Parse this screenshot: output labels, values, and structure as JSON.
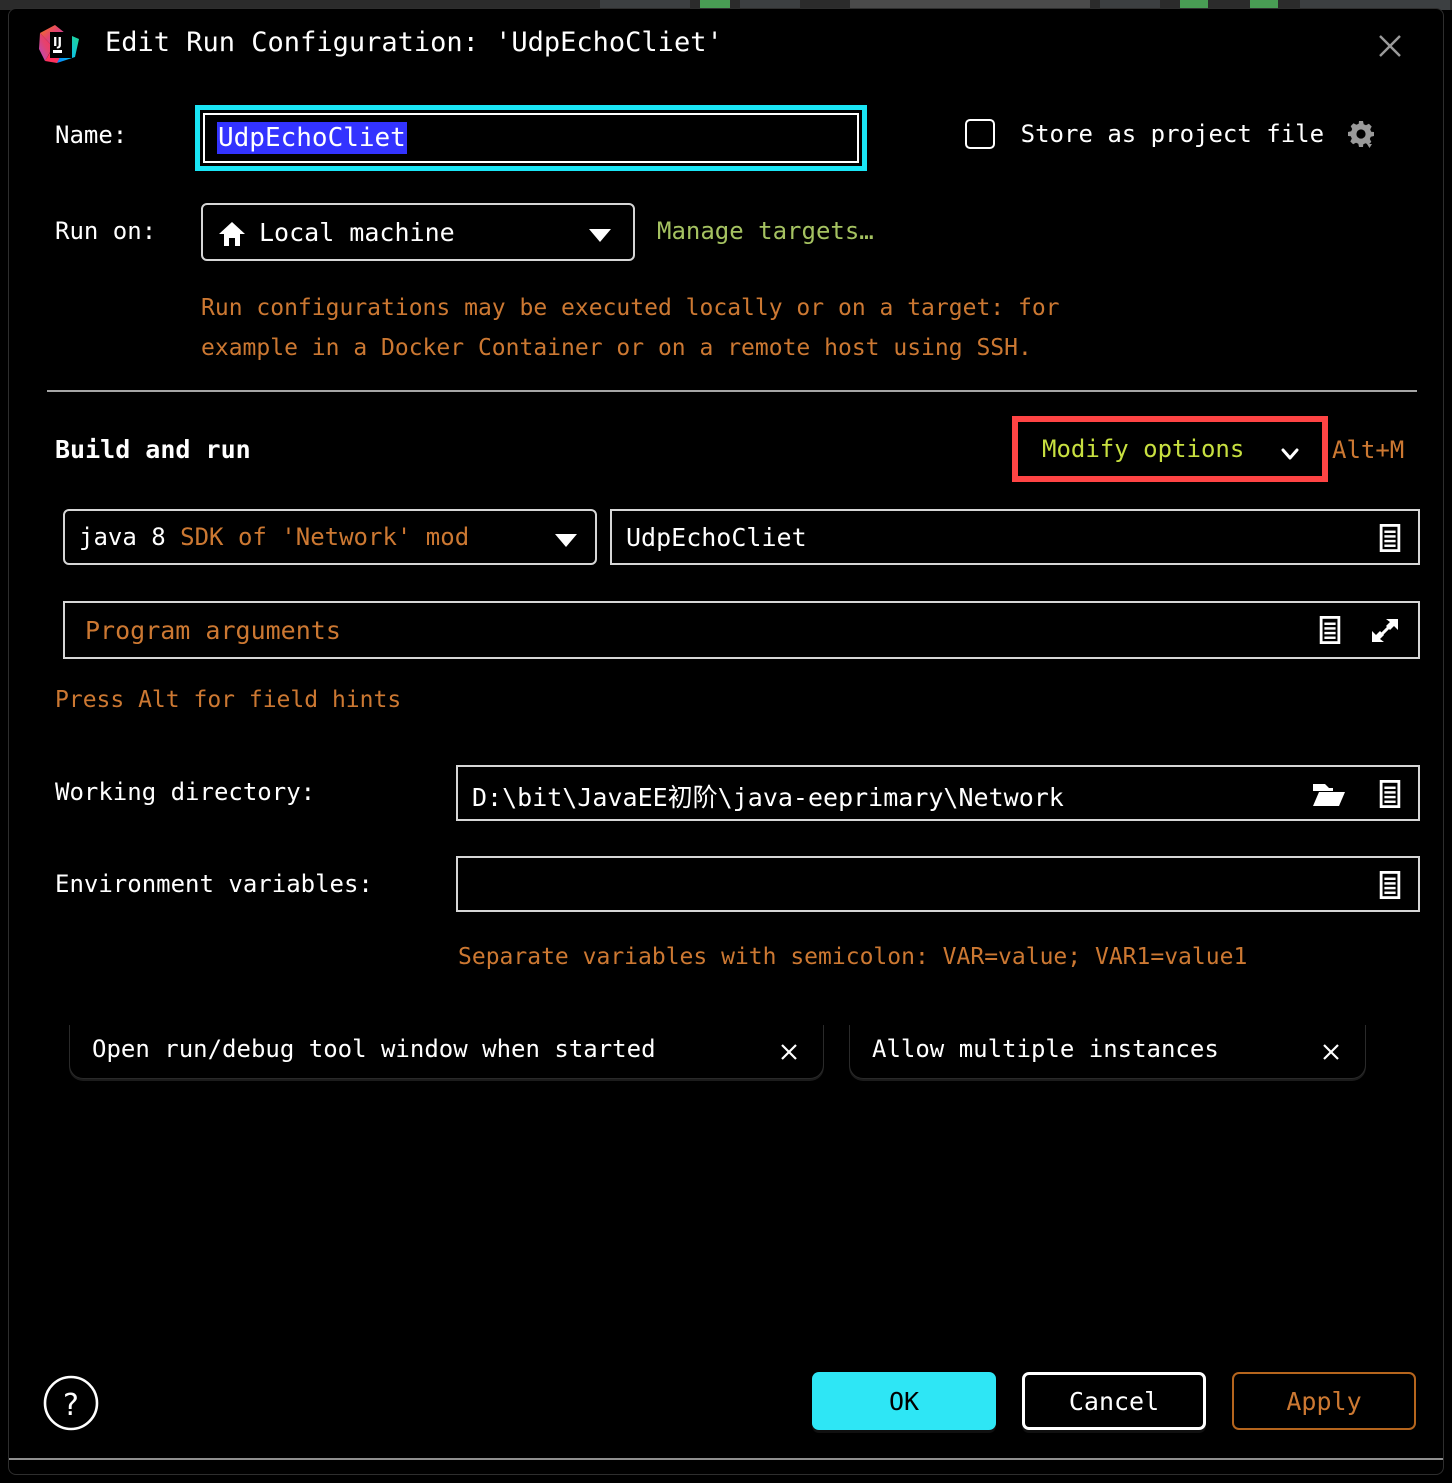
{
  "window": {
    "title": "Edit Run Configuration: 'UdpEchoCliet'",
    "logo_icon": "intellij-idea-logo",
    "close_icon": "close-icon"
  },
  "name_row": {
    "label": "Name:",
    "value": "UdpEchoCliet",
    "store_as_project_file_label": "Store as project file",
    "store_as_project_file_checked": false,
    "gear_icon": "gear-icon"
  },
  "run_on": {
    "label": "Run on:",
    "selected": "Local machine",
    "machine_icon": "home-icon",
    "manage_targets_link": "Manage targets…",
    "hint_line_1": "Run configurations may be executed locally or on a target: for",
    "hint_line_2": "example in a Docker Container or on a remote host using SSH."
  },
  "build_and_run": {
    "section_title": "Build and run",
    "modify_options_label": "Modify options",
    "modify_options_shortcut": "Alt+M",
    "sdk_prefix": "java 8",
    "sdk_suffix": "SDK of 'Network' mod",
    "main_class": "UdpEchoCliet",
    "program_arguments_placeholder": "Program arguments",
    "field_hints": "Press Alt for field hints"
  },
  "working_directory": {
    "label": "Working directory:",
    "value": "D:\\bit\\JavaEE初阶\\java-eeprimary\\Network",
    "browse_icon": "folder-icon",
    "macro_icon": "list-icon"
  },
  "environment_variables": {
    "label": "Environment variables:",
    "value": "",
    "macro_icon": "list-icon",
    "hint": "Separate variables with semicolon: VAR=value; VAR1=value1"
  },
  "option_chips": [
    {
      "label": "Open run/debug tool window when started",
      "remove_icon": "close-icon"
    },
    {
      "label": "Allow multiple instances",
      "remove_icon": "close-icon"
    }
  ],
  "footer": {
    "help_icon": "question-mark-icon",
    "ok_label": "OK",
    "cancel_label": "Cancel",
    "apply_label": "Apply"
  },
  "colors": {
    "accent_cyan": "#2ee6f5",
    "focus_ring": "#1ae5f5",
    "selection_blue": "#3333ff",
    "highlight_red": "#ff4444",
    "orange": "#cc7832",
    "green": "#a5c261",
    "yellow_green": "#c8e040",
    "background": "#000000"
  }
}
